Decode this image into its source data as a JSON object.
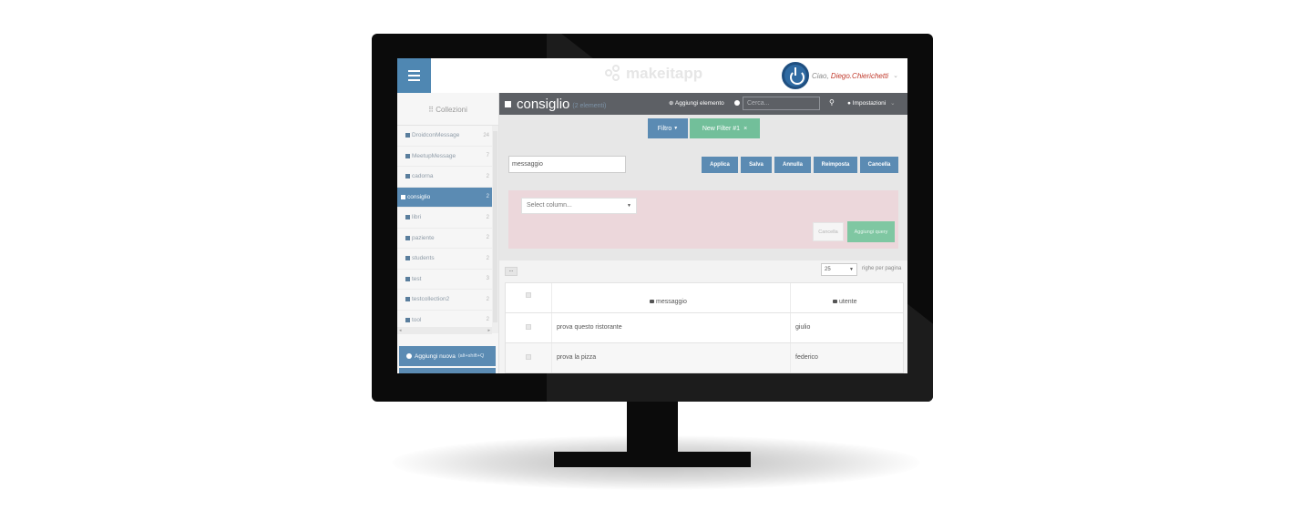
{
  "topbar": {
    "logo_text": "makeitapp",
    "greeting": "Ciao,",
    "username": "Diego.Chierichetti"
  },
  "sidebar": {
    "title": "Collezioni",
    "items": [
      {
        "label": "DroidconMessage",
        "count": "24"
      },
      {
        "label": "MeetupMessage",
        "count": "7"
      },
      {
        "label": "cadorna",
        "count": "2"
      },
      {
        "label": "consiglio",
        "count": "2",
        "active": true
      },
      {
        "label": "libri",
        "count": "2"
      },
      {
        "label": "paziente",
        "count": "2"
      },
      {
        "label": "students",
        "count": "2"
      },
      {
        "label": "test",
        "count": "3"
      },
      {
        "label": "testcollection2",
        "count": "2"
      },
      {
        "label": "tool",
        "count": "2"
      }
    ],
    "add_new_label": "Aggiungi nuova",
    "add_new_shortcut": "(alt+shift+Q"
  },
  "header": {
    "collection_title": "consiglio",
    "collection_count": "(2 elementi)",
    "add_element_label": "Aggiungi elemento",
    "search_placeholder": "Cerca...",
    "settings_label": "Impostazioni"
  },
  "filters": {
    "filter_button": "Filtro",
    "new_filter_label": "New Filter #1",
    "new_filter_close": "×",
    "field_value": "messaggio",
    "actions": [
      "Applica",
      "Salva",
      "Annulla",
      "Reimposta",
      "Cancella"
    ],
    "select_column_placeholder": "Select column...",
    "cancel_query_label": "Cancella",
    "add_query_label": "Aggiungi query"
  },
  "table": {
    "more_button": "...",
    "rows_per_page_value": "25",
    "rows_per_page_label": "righe per pagina",
    "columns": [
      "messaggio",
      "utente"
    ],
    "rows": [
      [
        "prova questo ristorante",
        "giulio"
      ],
      [
        "prova la pizza",
        "federico"
      ]
    ]
  },
  "colors": {
    "accent_blue": "#5b8bb3",
    "accent_green": "#72bf9a",
    "header_gray": "#5d6065",
    "query_pink": "#ecd7db",
    "username_red": "#c0392b"
  }
}
